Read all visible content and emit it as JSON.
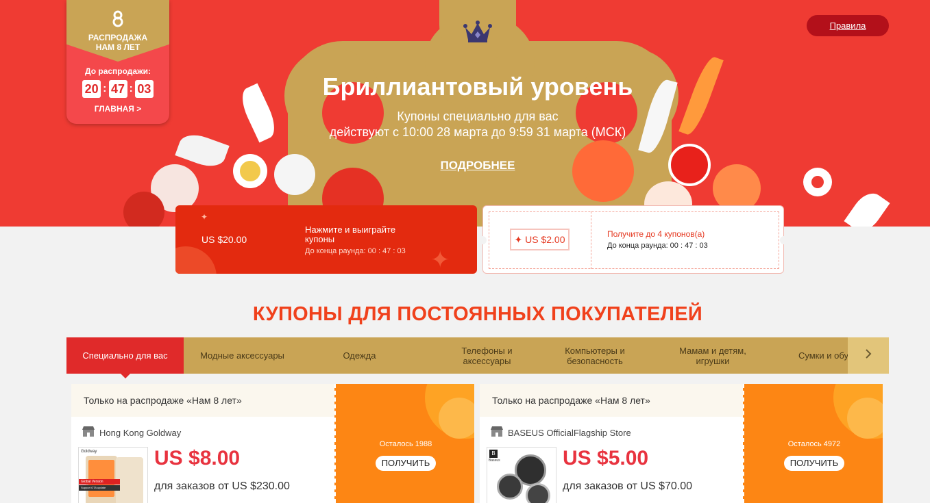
{
  "hero": {
    "title": "Бриллиантовый уровень",
    "subtitle1": "Купоны специально для вас",
    "subtitle2": "действуют с 10:00 28 марта до 9:59 31 марта (МСК)",
    "more_link": "ПОДРОБНЕЕ",
    "rules_button": "Правила",
    "crown_icon": "crown-icon",
    "colors": {
      "red": "#ef3b33",
      "gold": "#c9a455"
    }
  },
  "sale_badge": {
    "title_line1": "РАСПРОДАЖА",
    "title_line2": "НАМ 8 ЛЕТ",
    "countdown_label": "До распродажи:",
    "hours": "20",
    "minutes": "47",
    "seconds": "03",
    "home_link": "ГЛАВНАЯ >"
  },
  "top_coupons": [
    {
      "amount": "US $20.00",
      "message": "Нажмите и выиграйте купоны",
      "round_timer": "До конца раунда: 00 : 47 : 03"
    },
    {
      "amount": "US $2.00",
      "message": "Получите до 4 купонов(а)",
      "round_timer": "До конца раунда: 00 : 47 : 03"
    }
  ],
  "section_title": "КУПОНЫ ДЛЯ ПОСТОЯННЫХ ПОКУПАТЕЛЕЙ",
  "tabs": [
    {
      "label": "Специально для вас",
      "active": true
    },
    {
      "label": "Модные аксессуары"
    },
    {
      "label": "Одежда"
    },
    {
      "label": "Телефоны и аксессуары"
    },
    {
      "label": "Компьютеры и безопасность"
    },
    {
      "label": "Мамам и детям, игрушки"
    },
    {
      "label": "Сумки и обу"
    }
  ],
  "product_coupons": [
    {
      "header": "Только на распродаже «Нам 8 лет»",
      "store": "Hong Kong Goldway",
      "thumb_brand": "Goldway",
      "thumb_tag1": "Global Version",
      "thumb_tag2": "Support OTA update",
      "price": "US $8.00",
      "min_order": "для заказов от US $230.00",
      "remaining": "Осталось 1988",
      "get_button": "ПОЛУЧИТЬ"
    },
    {
      "header": "Только на распродаже «Нам 8 лет»",
      "store": "BASEUS OfficialFlagship Store",
      "thumb_brand": "Baseus",
      "price": "US $5.00",
      "min_order": "для заказов от US $70.00",
      "remaining": "Осталось 4972",
      "get_button": "ПОЛУЧИТЬ"
    }
  ]
}
